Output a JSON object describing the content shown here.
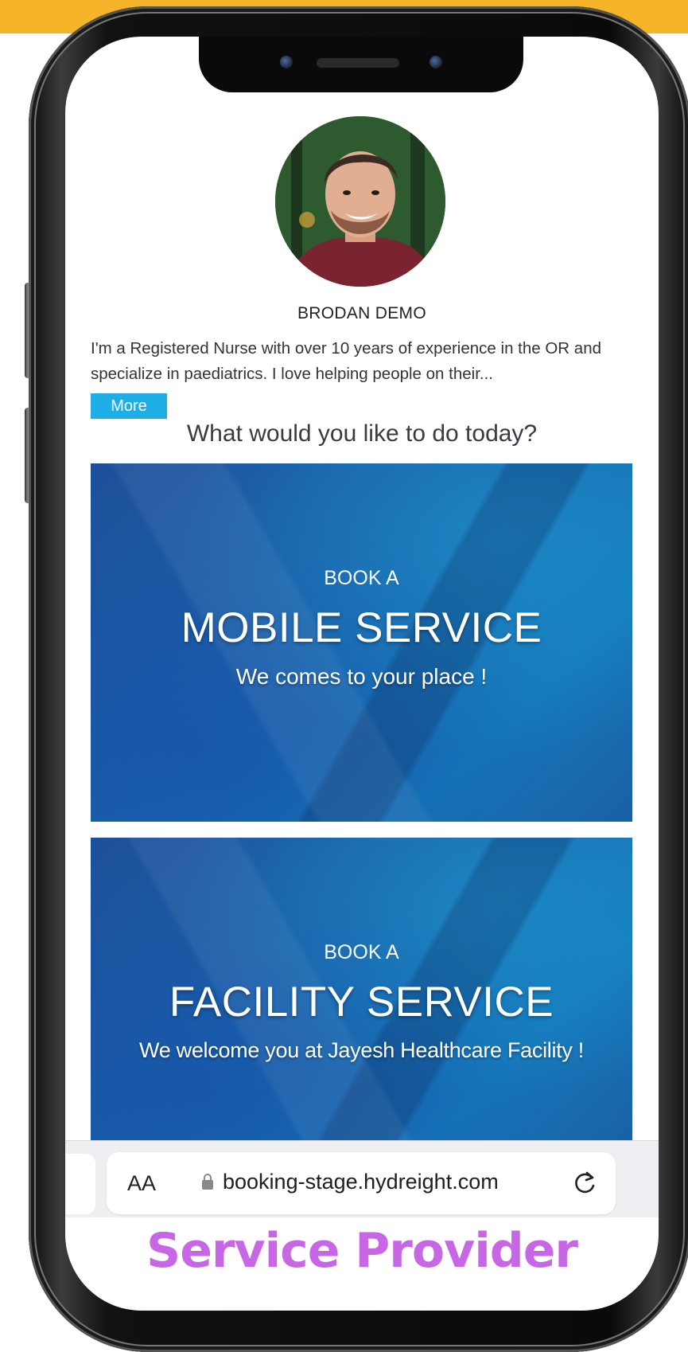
{
  "profile": {
    "name": "BRODAN DEMO",
    "bio": "I'm a Registered Nurse with over 10 years of experience in the OR and specialize in paediatrics. I love helping people on their...",
    "more_label": "More"
  },
  "prompt": "What would you like to do today?",
  "services": [
    {
      "prefix": "BOOK A",
      "title": "MOBILE SERVICE",
      "subtitle": "We comes to your place !"
    },
    {
      "prefix": "BOOK A",
      "title": "FACILITY SERVICE",
      "subtitle": "We welcome you at Jayesh Healthcare Facility !"
    }
  ],
  "browser": {
    "text_size_label": "AA",
    "url": "booking-stage.hydreight.com",
    "lock_icon": "lock-icon",
    "reload_icon": "reload-icon"
  },
  "caption": "Service Provider",
  "colors": {
    "top_bar": "#f5b429",
    "more_button": "#1eaee6",
    "card_blue": "#1b63ab",
    "caption": "#c767e6"
  }
}
